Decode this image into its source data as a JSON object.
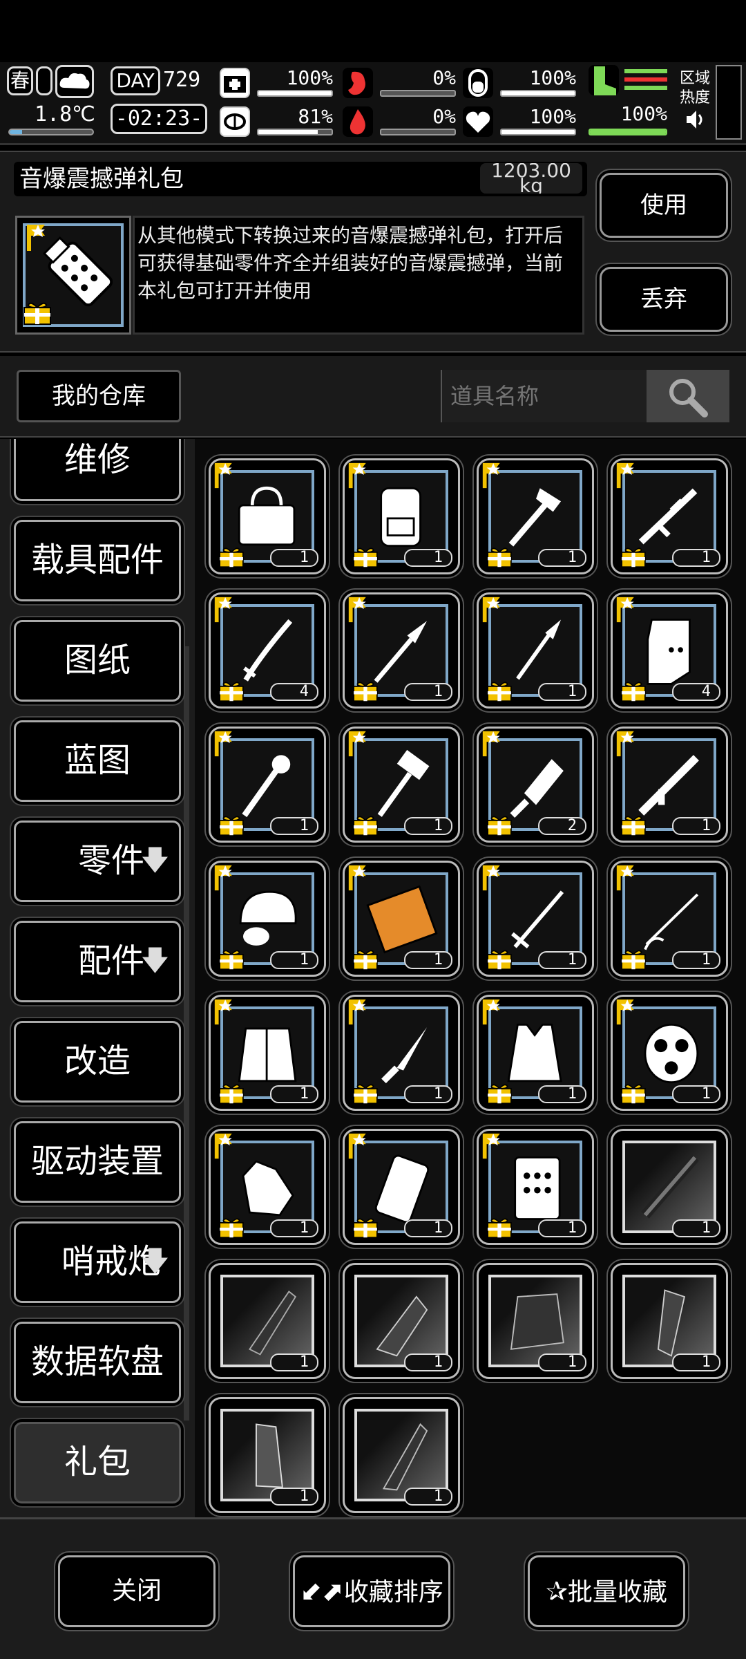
{
  "status": {
    "season": "春",
    "temperature": "1.8℃",
    "day_label": "DAY",
    "day_number": "729",
    "clock": "-02:23-",
    "health_pct": "100%",
    "health_value": 1.0,
    "hunger_pct": "0%",
    "hunger_value": 0.0,
    "stomach_pct": "100%",
    "stomach_value": 1.0,
    "mind_pct": "81%",
    "mind_value": 0.81,
    "bleed_pct": "0%",
    "bleed_value": 0.0,
    "heart_pct": "100%",
    "heart_value": 1.0,
    "stamina_pct": "100%",
    "stamina_value": 1.0,
    "region_heat_label": "区域热度"
  },
  "item": {
    "name": "音爆震撼弹礼包",
    "weight": "1203.00 kg",
    "description": "从其他模式下转换过来的音爆震撼弹礼包，打开后可获得基础零件齐全并组装好的音爆震撼弹，当前本礼包可打开并使用",
    "use_label": "使用",
    "discard_label": "丢弃"
  },
  "search": {
    "warehouse_label": "我的仓库",
    "placeholder": "道具名称"
  },
  "categories": [
    {
      "label": "维修",
      "arrow": ""
    },
    {
      "label": "载具配件",
      "arrow": ""
    },
    {
      "label": "图纸",
      "arrow": ""
    },
    {
      "label": "蓝图",
      "arrow": ""
    },
    {
      "label": "零件",
      "arrow": "🡇"
    },
    {
      "label": "配件",
      "arrow": "🡇"
    },
    {
      "label": "改造",
      "arrow": ""
    },
    {
      "label": "驱动装置",
      "arrow": ""
    },
    {
      "label": "哨戒炮",
      "arrow": "🡇"
    },
    {
      "label": "数据软盘",
      "arrow": ""
    },
    {
      "label": "礼包",
      "arrow": ""
    }
  ],
  "grid_items": [
    {
      "name": "bag",
      "count": "1",
      "style": "gift"
    },
    {
      "name": "backpack",
      "count": "1",
      "style": "gift"
    },
    {
      "name": "axe-hammer",
      "count": "1",
      "style": "gift"
    },
    {
      "name": "rifle",
      "count": "1",
      "style": "gift"
    },
    {
      "name": "katana",
      "count": "4",
      "style": "gift"
    },
    {
      "name": "spear",
      "count": "1",
      "style": "gift"
    },
    {
      "name": "spear-tip",
      "count": "1",
      "style": "gift"
    },
    {
      "name": "riot-shield",
      "count": "4",
      "style": "gift"
    },
    {
      "name": "spiked-club",
      "count": "1",
      "style": "gift"
    },
    {
      "name": "sledgehammer",
      "count": "1",
      "style": "gift"
    },
    {
      "name": "cleaver",
      "count": "2",
      "style": "gift"
    },
    {
      "name": "launcher",
      "count": "1",
      "style": "gift"
    },
    {
      "name": "helmet",
      "count": "1",
      "style": "gift"
    },
    {
      "name": "grenade-pack",
      "count": "1",
      "style": "gift"
    },
    {
      "name": "longsword",
      "count": "1",
      "style": "gift"
    },
    {
      "name": "rapier",
      "count": "1",
      "style": "gift"
    },
    {
      "name": "fur-coat",
      "count": "1",
      "style": "gift"
    },
    {
      "name": "knife",
      "count": "1",
      "style": "gift"
    },
    {
      "name": "vest",
      "count": "1",
      "style": "gift"
    },
    {
      "name": "gas-mask",
      "count": "1",
      "style": "gift"
    },
    {
      "name": "gloves",
      "count": "1",
      "style": "gift"
    },
    {
      "name": "armor-plate",
      "count": "1",
      "style": "gift"
    },
    {
      "name": "ceramic-plate",
      "count": "1",
      "style": "gift"
    },
    {
      "name": "mech-arm",
      "count": "1",
      "style": "dark"
    },
    {
      "name": "vehicle-chassis",
      "count": "1",
      "style": "dark"
    },
    {
      "name": "mech-claw",
      "count": "1",
      "style": "dark"
    },
    {
      "name": "mech-torso",
      "count": "1",
      "style": "dark"
    },
    {
      "name": "mech-limb",
      "count": "1",
      "style": "dark"
    },
    {
      "name": "mech-leg",
      "count": "1",
      "style": "dark"
    },
    {
      "name": "mech-blade",
      "count": "1",
      "style": "dark"
    }
  ],
  "bottom": {
    "close_label": "关闭",
    "sort_label": "收藏排序",
    "batch_label": "批量收藏"
  },
  "colors": {
    "slot_frame": "#7fa7c8",
    "gift_yellow": "#f2c200",
    "stamina_green": "#7ed957"
  }
}
